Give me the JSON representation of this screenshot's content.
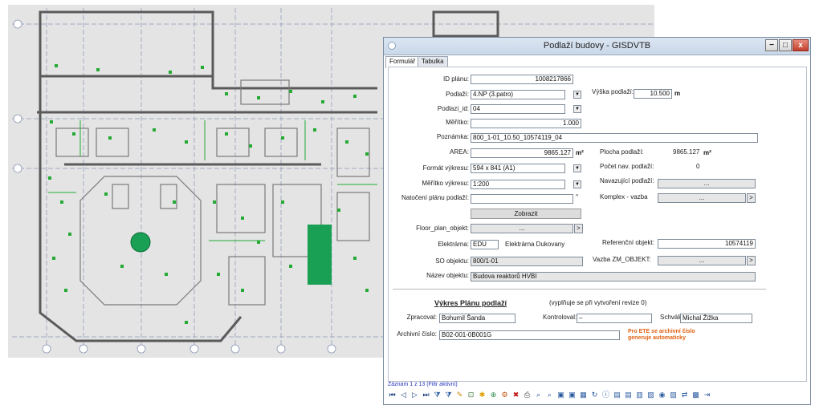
{
  "window": {
    "title": "Podlaží budovy - GISDVTB",
    "minimize": "−",
    "maximize": "□",
    "close": "x"
  },
  "tabs": [
    {
      "label": "Formulář"
    },
    {
      "label": "Tabulka"
    }
  ],
  "form": {
    "id_planu": {
      "label": "ID plánu:",
      "value": "1008217866"
    },
    "podlazi": {
      "label": "Podlaží:",
      "value": "4.NP (3.patro)"
    },
    "vyska_podlazi": {
      "label": "Výška podlaží:",
      "value": "10.500",
      "unit": "m"
    },
    "podlazi_id": {
      "label": "Podlazi_id:",
      "value": "04"
    },
    "meritko": {
      "label": "Měřítko:",
      "value": "1.000"
    },
    "poznamka": {
      "label": "Poznámka:",
      "value": "800_1-01_10.50_10574119_04"
    },
    "area": {
      "label": "AREA:",
      "value": "9865.127",
      "unit": "m²"
    },
    "plocha_podlazi": {
      "label": "Plocha podlaží:",
      "value": "9865.127",
      "unit": "m²"
    },
    "format_vykresu": {
      "label": "Formát výkresu:",
      "value": "594 x 841 (A1)"
    },
    "pocet_nav_podlazi": {
      "label": "Počet nav. podlaží:",
      "value": "0"
    },
    "meritko_vykresu": {
      "label": "Měřítko výkresu:",
      "value": "1:200"
    },
    "navazujici_podlazi": {
      "label": "Navazující podlaží:",
      "value": "..."
    },
    "natoceni": {
      "label": "Natočení plánu podlaží:",
      "value": "",
      "unit": "°"
    },
    "komplex_vazba": {
      "label": "Komplex - vazba",
      "value": "..."
    },
    "zobrazit": {
      "label": "Zobrazit"
    },
    "floor_plan_objekt": {
      "label": "Floor_plan_objekt:",
      "value": "..."
    },
    "elektrarna": {
      "label": "Elektrárna:",
      "code": "EDU",
      "name": "Elektrárna Dukovany"
    },
    "referencni_objekt": {
      "label": "Referenční objekt:",
      "value": "10574119"
    },
    "so_objektu": {
      "label": "SO objektu:",
      "value": "800/1-01"
    },
    "vazba_zm": {
      "label": "Vazba ZM_OBJEKT:",
      "value": "..."
    },
    "nazev_objektu": {
      "label": "Název objektu:",
      "value": "Budova reaktorů HVBI"
    },
    "expand": ">"
  },
  "vykres": {
    "heading": "Výkres Plánu podlaží",
    "note": "(vyplňuje se při vytvoření revize 0)",
    "zpracoval": {
      "label": "Zpracoval:",
      "value": "Bohumil Šanda"
    },
    "kontroloval": {
      "label": "Kontroloval:",
      "value": "–"
    },
    "schvalil": {
      "label": "Schválil:",
      "value": "Michal Žižka"
    },
    "archivni_cislo": {
      "label": "Archivní číslo:",
      "value": "B02-001-0B001G"
    },
    "archive_note": "Pro ETE se archivní číslo generuje automaticky"
  },
  "status": {
    "record_text": "Záznam 1 z 13 (Filtr aktivní)"
  },
  "toolbar": {
    "icons": [
      {
        "name": "first-record-icon",
        "glyph": "⏮",
        "color": "#1a3d7a"
      },
      {
        "name": "prev-record-icon",
        "glyph": "◁",
        "color": "#1a3d7a"
      },
      {
        "name": "next-record-icon",
        "glyph": "▷",
        "color": "#1a3d7a"
      },
      {
        "name": "last-record-icon",
        "glyph": "⏭",
        "color": "#1a3d7a"
      },
      {
        "name": "filter-icon",
        "glyph": "⧩",
        "color": "#2a5aa0"
      },
      {
        "name": "filter-clear-icon",
        "glyph": "⧩",
        "color": "#2a5aa0"
      },
      {
        "name": "edit-icon",
        "glyph": "✎",
        "color": "#d08a10"
      },
      {
        "name": "select-icon",
        "glyph": "⊡",
        "color": "#3a7a3a"
      },
      {
        "name": "new-record-icon",
        "glyph": "✱",
        "color": "#e0a000"
      },
      {
        "name": "copy-record-icon",
        "glyph": "⊕",
        "color": "#2a8a4a"
      },
      {
        "name": "settings-icon",
        "glyph": "⚙",
        "color": "#c05010"
      },
      {
        "name": "delete-icon",
        "glyph": "✖",
        "color": "#c01818"
      },
      {
        "name": "print-icon",
        "glyph": "⎙",
        "color": "#444444"
      },
      {
        "name": "zoom-icon",
        "glyph": "⌕",
        "color": "#2a5aa0"
      },
      {
        "name": "search-icon",
        "glyph": "⌕",
        "color": "#2a5aa0"
      },
      {
        "name": "window-icon",
        "glyph": "▣",
        "color": "#2a5aa0"
      },
      {
        "name": "window-2-icon",
        "glyph": "▣",
        "color": "#2a5aa0"
      },
      {
        "name": "grid-icon",
        "glyph": "▦",
        "color": "#2a5aa0"
      },
      {
        "name": "refresh-icon",
        "glyph": "↻",
        "color": "#2a5aa0"
      },
      {
        "name": "info-icon",
        "glyph": "ⓘ",
        "color": "#2a5aa0"
      },
      {
        "name": "report-icon",
        "glyph": "▤",
        "color": "#2a5aa0"
      },
      {
        "name": "report-2-icon",
        "glyph": "▤",
        "color": "#2a5aa0"
      },
      {
        "name": "export-icon",
        "glyph": "▥",
        "color": "#2a5aa0"
      },
      {
        "name": "document-icon",
        "glyph": "▧",
        "color": "#2a5aa0"
      },
      {
        "name": "map-icon",
        "glyph": "◉",
        "color": "#2a5aa0"
      },
      {
        "name": "chart-icon",
        "glyph": "▨",
        "color": "#2a5aa0"
      },
      {
        "name": "transfer-icon",
        "glyph": "⇄",
        "color": "#2a5aa0"
      },
      {
        "name": "layers-icon",
        "glyph": "▩",
        "color": "#2a5aa0"
      },
      {
        "name": "exit-icon",
        "glyph": "⇥",
        "color": "#2a5aa0"
      }
    ]
  }
}
